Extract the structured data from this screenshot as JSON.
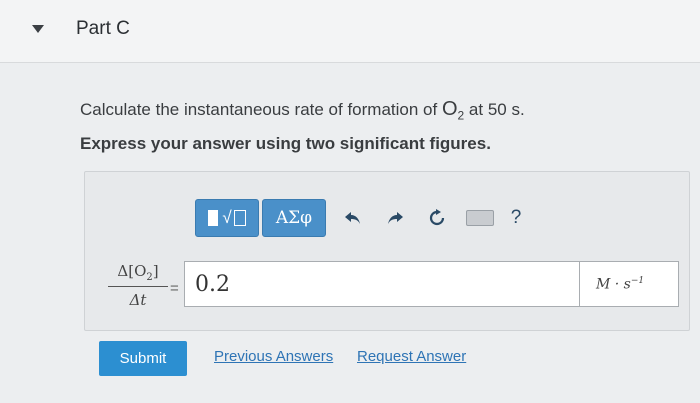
{
  "part": {
    "title": "Part C"
  },
  "question": {
    "text_before": "Calculate the instantaneous rate of formation of ",
    "species": "O",
    "species_sub": "2",
    "text_after": " at 50 s.",
    "instruction": "Express your answer using two significant figures."
  },
  "toolbar": {
    "templates_glyph": "√",
    "greek_label": "ΑΣφ",
    "help_label": "?",
    "icons": [
      "templates-icon",
      "greek-letters-icon",
      "undo-icon",
      "redo-icon",
      "reset-icon",
      "keyboard-icon",
      "help-icon"
    ]
  },
  "answer": {
    "lhs_numerator": "Δ[O",
    "lhs_numerator_sub": "2",
    "lhs_numerator_close": "]",
    "lhs_denominator": "Δt",
    "equals": "=",
    "value": "0.2",
    "units_base": "M · s",
    "units_exp": "−1"
  },
  "actions": {
    "submit_label": "Submit",
    "previous_answers_label": "Previous Answers",
    "request_answer_label": "Request Answer"
  },
  "colors": {
    "accent": "#2c8fd1",
    "toolbar_button": "#4a90c9",
    "link": "#2e74b5"
  }
}
